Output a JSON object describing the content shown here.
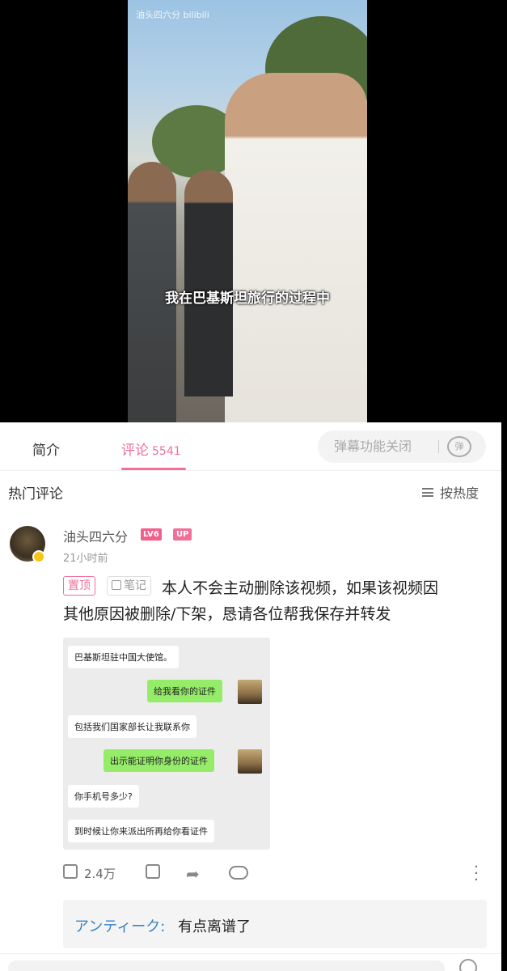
{
  "video": {
    "watermark": "油头四六分 bilibili",
    "subtitle": "我在巴基斯坦旅行的过程中"
  },
  "tabs": {
    "intro": "简介",
    "comments": "评论",
    "comment_count": "5541",
    "danmaku_toggle": "弹幕功能关闭",
    "danmaku_icon_label": "弹"
  },
  "hot": {
    "title": "热门评论",
    "sort_label": "按热度"
  },
  "comment": {
    "username": "油头四六分",
    "level": "LV6",
    "up_badge": "UP",
    "time": "21小时前",
    "pin_tag": "置顶",
    "note_tag": "笔记",
    "line1": "本人不会主动删除该视频，如果该视频因",
    "line2": "其他原因被删除/下架，恳请各位帮我保存并转发",
    "like_count": "2.4万",
    "chat": [
      {
        "side": "left",
        "text": "巴基斯坦驻中国大使馆。"
      },
      {
        "side": "right",
        "text": "给我看你的证件"
      },
      {
        "side": "left",
        "text": "包括我们国家部长让我联系你"
      },
      {
        "side": "right",
        "text": "出示能证明你身份的证件"
      },
      {
        "side": "left",
        "text": "你手机号多少?"
      },
      {
        "side": "left",
        "text": "到时候让你来派出所再给你看证件"
      }
    ]
  },
  "reply": {
    "author": "アンティーク:",
    "text": "有点离谱了"
  },
  "colors": {
    "accent": "#f0709a",
    "link": "#3a82c4",
    "chat_green": "#95ec69"
  }
}
